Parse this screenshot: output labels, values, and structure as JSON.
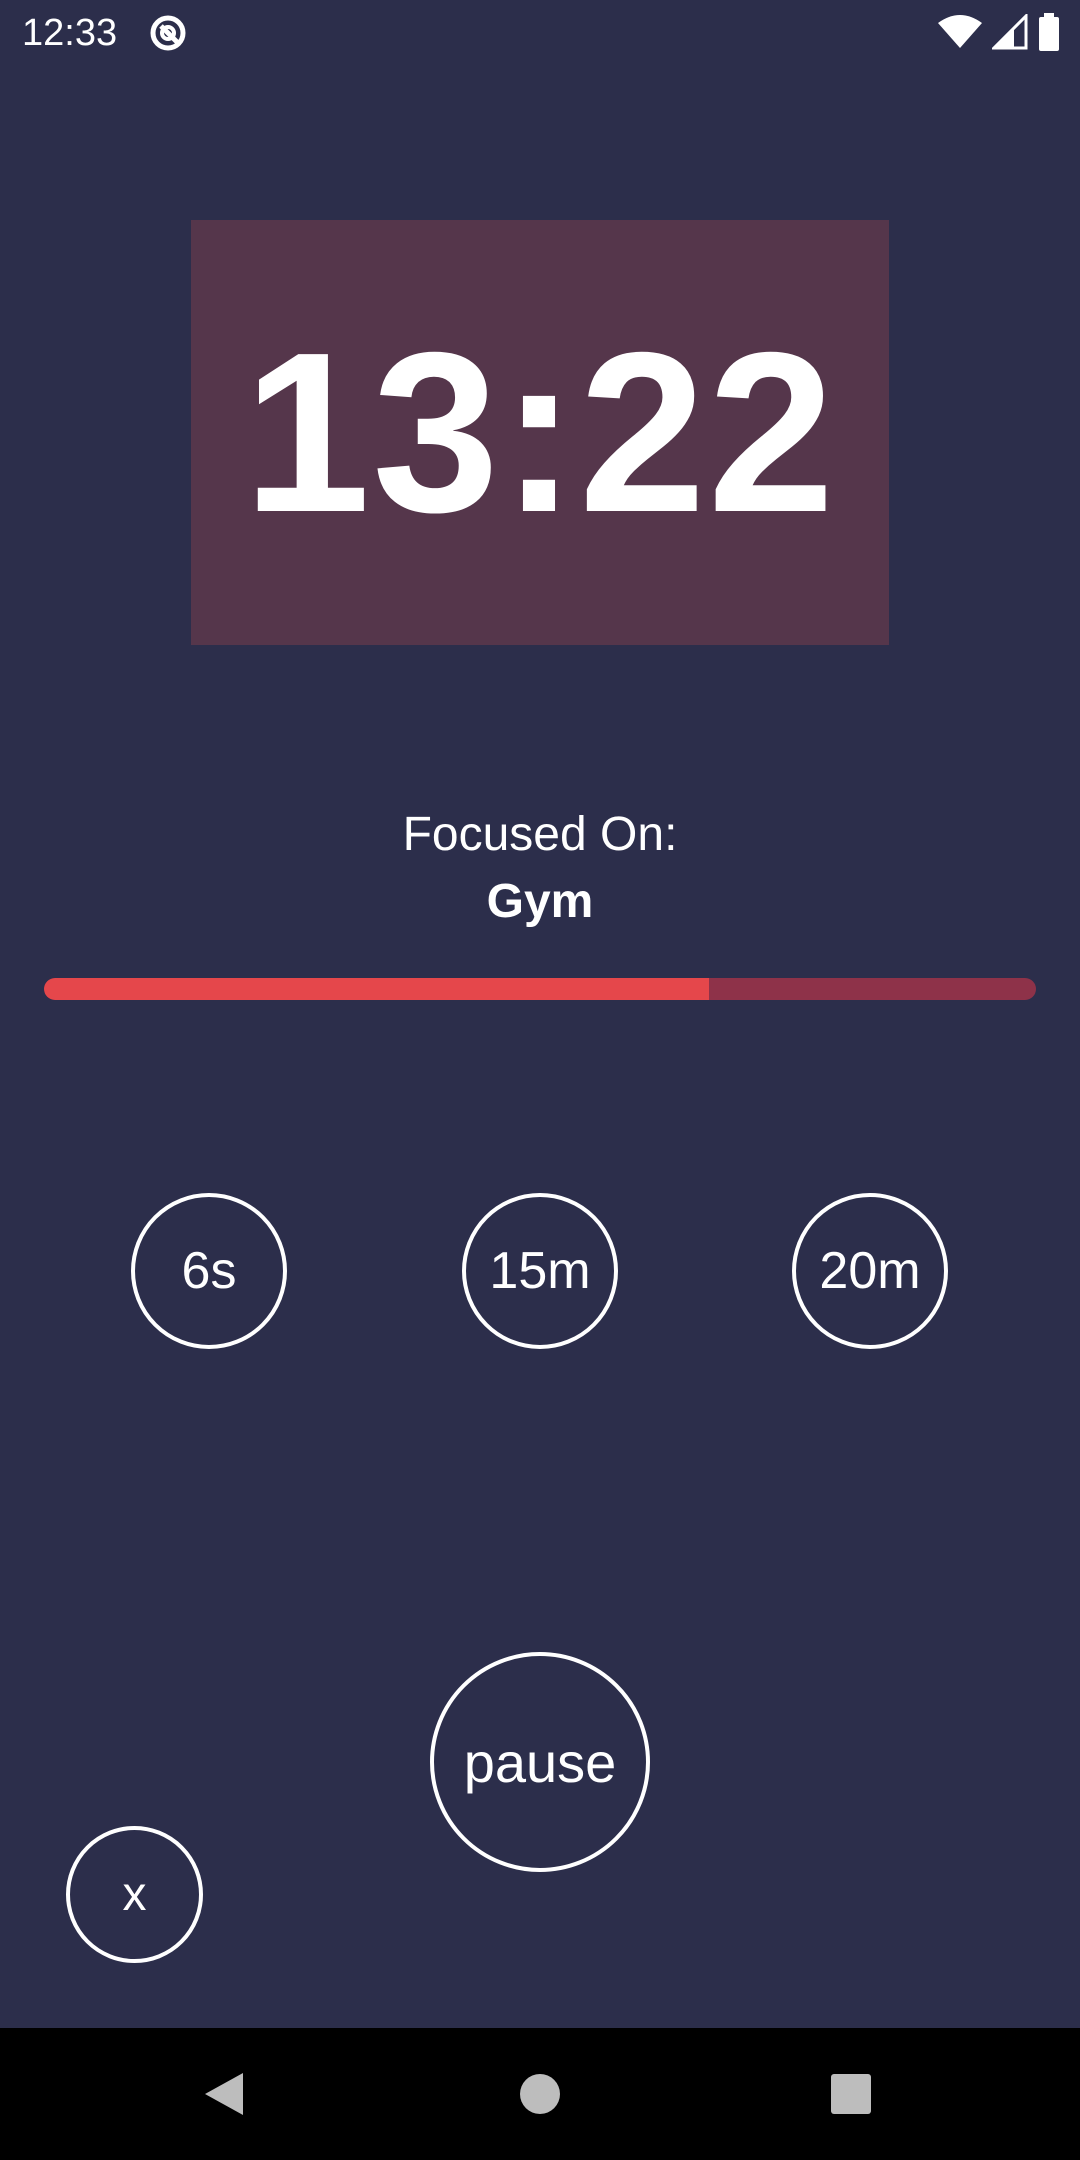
{
  "status_bar": {
    "time": "12:33",
    "icons": [
      "app-notification-icon",
      "wifi-icon",
      "cell-signal-icon",
      "battery-icon"
    ]
  },
  "timer": {
    "display": "13:22"
  },
  "focus": {
    "label": "Focused On:",
    "subject": "Gym"
  },
  "progress": {
    "fraction": 0.67
  },
  "presets": [
    {
      "label": "6s"
    },
    {
      "label": "15m"
    },
    {
      "label": "20m"
    }
  ],
  "controls": {
    "pause_label": "pause",
    "close_label": "x"
  },
  "nav_bar": {
    "icons": [
      "back-icon",
      "home-icon",
      "recents-icon"
    ]
  },
  "colors": {
    "background": "#2c2e4b",
    "timer_box": "#55364b",
    "progress_fill": "#e5474b",
    "progress_track": "#8e3249",
    "nav_bar": "#000000"
  }
}
